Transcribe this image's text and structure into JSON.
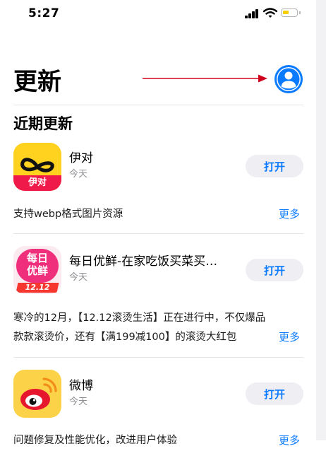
{
  "status_bar": {
    "time": "5:27"
  },
  "header": {
    "title": "更新"
  },
  "section": {
    "title": "近期更新"
  },
  "updates": [
    {
      "name": "伊对",
      "date": "今天",
      "button": "打开",
      "notes": "支持webp格式图片资源",
      "more": "更多",
      "icon_text": "伊对"
    },
    {
      "name": "每日优鲜-在家吃饭买菜买…",
      "date": "今天",
      "button": "打开",
      "notes_lines": [
        "寒冷的12月，【12.12滚烫生活】正在进行中，不仅爆品",
        "款款滚烫价，还有【满199减100】的滚烫大红包"
      ],
      "more": "更多",
      "icon_top": "每日",
      "icon_mid": "优鲜",
      "icon_badge": "12.12"
    },
    {
      "name": "微博",
      "date": "今天",
      "button": "打开",
      "notes": "问题修复及性能优化，改进用户体验",
      "more": "更多"
    }
  ],
  "colors": {
    "accent": "#0a7aff",
    "button_bg": "#eeeef3",
    "arrow": "#d0021b",
    "battery": "#f7ce00"
  }
}
